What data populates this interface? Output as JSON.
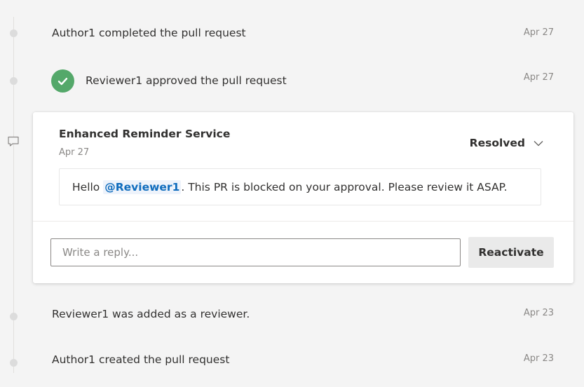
{
  "timeline": {
    "events_before": [
      {
        "text": "Author1 completed the pull request",
        "date": "Apr 27"
      },
      {
        "text": "Reviewer1 approved the pull request",
        "date": "Apr 27"
      }
    ],
    "events_after": [
      {
        "text": "Reviewer1 was added as a reviewer.",
        "date": "Apr 23"
      },
      {
        "text": "Author1 created the pull request",
        "date": "Apr 23"
      }
    ]
  },
  "thread": {
    "author": "Enhanced Reminder Service",
    "date": "Apr 27",
    "status": "Resolved",
    "comment": {
      "prefix": "Hello ",
      "mention": "@Reviewer1",
      "suffix": ". This PR is blocked on your approval. Please review it ASAP."
    },
    "reply_placeholder": "Write a reply...",
    "reply_value": "",
    "reactivate_label": "Reactivate"
  },
  "icons": {
    "approved": "checkmark-circle-icon",
    "comment": "comment-icon",
    "dropdown": "chevron-down-icon"
  },
  "colors": {
    "approved_green": "#54a86a",
    "mention_blue": "#0f6cbd"
  }
}
